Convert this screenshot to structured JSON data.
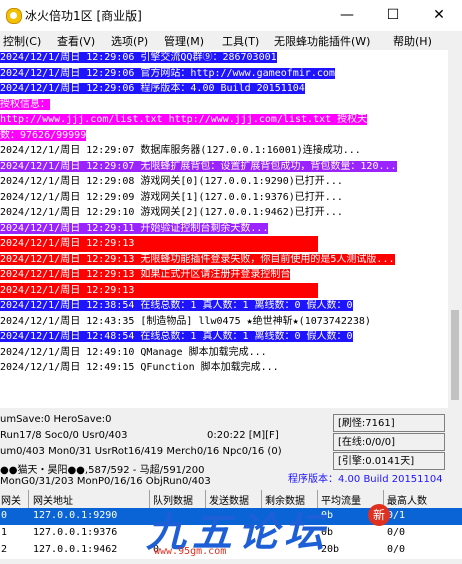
{
  "window": {
    "title": "冰火倍功1区 [商业版]",
    "minimize": "—",
    "maximize": "☐",
    "close": "✕"
  },
  "menu": [
    "控制(C)",
    "查看(V)",
    "选项(P)",
    "管理(M)",
    "工具(T)",
    "无限蜂功能插件(W)",
    "帮助(H)"
  ],
  "log": [
    {
      "text": "2024/12/1/周日 12:29:06 引擎交流QQ群⑨：286703001",
      "style": "bg-blue"
    },
    {
      "text": "2024/12/1/周日 12:29:06 官方网站：http://www.gameofmir.com",
      "style": "bg-blue"
    },
    {
      "text": "2024/12/1/周日 12:29:06 程序版本：4.00 Build 20151104",
      "style": "bg-blue"
    },
    {
      "text": "授权信息：",
      "style": "bg-magenta"
    },
    {
      "text": "http://www.jjj.com/list.txt http://www.jjj.com/list.txt 授权天",
      "style": "bg-magenta"
    },
    {
      "text": "数：97626/99999",
      "style": "bg-magenta"
    },
    {
      "text": "2024/12/1/周日 12:29:07 数据库服务器(127.0.0.1:16001)连接成功...",
      "style": "plain"
    },
    {
      "text": "2024/12/1/周日 12:29:07 无限蜂扩展背包：设置扩展背包成功，背包数量：120...",
      "style": "bg-purple"
    },
    {
      "text": "2024/12/1/周日 12:29:08 游戏网关[0](127.0.0.1:9290)已打开...",
      "style": "plain"
    },
    {
      "text": "2024/12/1/周日 12:29:09 游戏网关[1](127.0.0.1:9376)已打开...",
      "style": "plain"
    },
    {
      "text": "2024/12/1/周日 12:29:10 游戏网关[2](127.0.0.1:9462)已打开...",
      "style": "plain"
    },
    {
      "text": "2024/12/1/周日 12:29:11 开始验证控制台剩余天数...",
      "style": "bg-purple"
    },
    {
      "text": "2024/12/1/周日 12:29:13 ",
      "style": "bg-red"
    },
    {
      "text": "2024/12/1/周日 12:29:13 无限蜂功能插件登录失败，你目前使用的是5人测试版...",
      "style": "bg-red"
    },
    {
      "text": "2024/12/1/周日 12:29:13 如果正式开区请注册并登录控制台",
      "style": "bg-red"
    },
    {
      "text": "2024/12/1/周日 12:29:13 ",
      "style": "bg-red"
    },
    {
      "text": "2024/12/1/周日 12:38:54 在线总数：1 真人数：1 离线数：0 假人数：0",
      "style": "bg-blue"
    },
    {
      "text": "2024/12/1/周日 12:43:35 [制造物品] llw0475 ★绝世神斩★(1073742238)",
      "style": "plain"
    },
    {
      "text": "2024/12/1/周日 12:48:54 在线总数：1 真人数：1 离线数：0 假人数：0",
      "style": "bg-blue"
    },
    {
      "text": "2024/12/1/周日 12:49:10 QManage 脚本加载完成...",
      "style": "plain"
    },
    {
      "text": "2024/12/1/周日 12:49:15 QFunction 脚本加载完成...",
      "style": "plain"
    }
  ],
  "stats": {
    "line1": "umSave:0 HeroSave:0",
    "line2": "Run17/8 Soc0/0 Usr0/403",
    "time": "0:20:22 [M][F]",
    "line3": "um0/403 Mon0/31 UsrRot16/419 Merch0/16 Npc0/16 (0)",
    "line4": "●●猫天・昊阳●●,587/592 - 马超/591/200",
    "line5": "MonG0/31/203 MonP0/16/16 ObjRun0/403",
    "counter_refresh": "[刷怪:7161]",
    "counter_online": "[在线:0/0/0]",
    "counter_engine": "[引擎:0.0141天]",
    "version": "程序版本：4.00 Build 20151104"
  },
  "grid": {
    "headers": [
      "网关",
      "网关地址",
      "队列数据",
      "发送数据",
      "剩余数据",
      "平均流量",
      "最高人数"
    ],
    "rows": [
      {
        "id": "0",
        "addr": "127.0.0.1:9290",
        "queue": "",
        "send": "",
        "remain": "",
        "avg": "0b",
        "max": "0/1"
      },
      {
        "id": "1",
        "addr": "127.0.0.1:9376",
        "queue": "",
        "send": "",
        "remain": "",
        "avg": "0b",
        "max": "0/0"
      },
      {
        "id": "2",
        "addr": "127.0.0.1:9462",
        "queue": "0",
        "send": "",
        "remain": "",
        "avg": "20b",
        "max": "0/0"
      }
    ]
  },
  "watermark": {
    "brand": "九五论坛",
    "url": "www.95gm.com",
    "badge": "新"
  }
}
